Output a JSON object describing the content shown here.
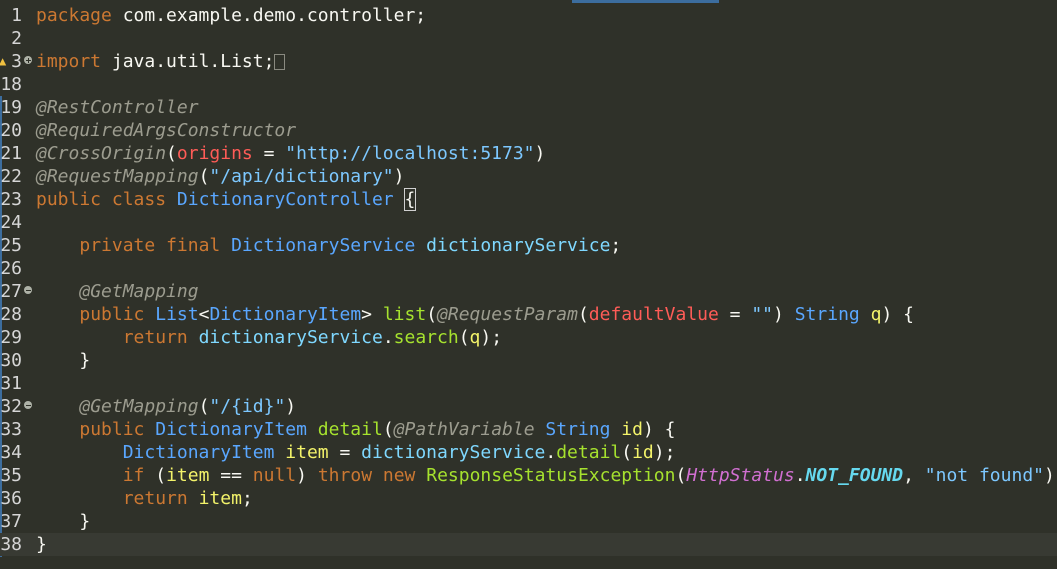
{
  "editor": {
    "lines": [
      {
        "n": "1",
        "tokens": [
          [
            "kw",
            "package"
          ],
          [
            "pl",
            " com.example.demo.controller;"
          ]
        ]
      },
      {
        "n": "2",
        "tokens": []
      },
      {
        "n": "3",
        "fold": "plus",
        "warn": true,
        "tokens": [
          [
            "kw",
            "import"
          ],
          [
            "pl",
            " java.util.List;"
          ]
        ],
        "collapsed": true
      },
      {
        "n": "18",
        "tokens": []
      },
      {
        "n": "19",
        "tokens": [
          [
            "an",
            "@RestController"
          ]
        ]
      },
      {
        "n": "20",
        "tokens": [
          [
            "an",
            "@RequiredArgsConstructor"
          ]
        ]
      },
      {
        "n": "21",
        "tokens": [
          [
            "an",
            "@CrossOrigin"
          ],
          [
            "pl",
            "("
          ],
          [
            "pm",
            "origins"
          ],
          [
            "pl",
            " = "
          ],
          [
            "st",
            "\"http://localhost:5173\""
          ],
          [
            "pl",
            ")"
          ]
        ]
      },
      {
        "n": "22",
        "tokens": [
          [
            "an",
            "@RequestMapping"
          ],
          [
            "pl",
            "("
          ],
          [
            "st",
            "\"/api/dictionary\""
          ],
          [
            "pl",
            ")"
          ]
        ]
      },
      {
        "n": "23",
        "tokens": [
          [
            "kw",
            "public"
          ],
          [
            "pl",
            " "
          ],
          [
            "kw",
            "class"
          ],
          [
            "pl",
            " "
          ],
          [
            "tp",
            "DictionaryController"
          ],
          [
            "pl",
            " "
          ],
          [
            "brace",
            "{"
          ]
        ]
      },
      {
        "n": "24",
        "tokens": []
      },
      {
        "n": "25",
        "tokens": [
          [
            "pl",
            "    "
          ],
          [
            "kw",
            "private"
          ],
          [
            "pl",
            " "
          ],
          [
            "kw",
            "final"
          ],
          [
            "pl",
            " "
          ],
          [
            "tp",
            "DictionaryService"
          ],
          [
            "pl",
            " "
          ],
          [
            "fld",
            "dictionaryService"
          ],
          [
            "pl",
            ";"
          ]
        ]
      },
      {
        "n": "26",
        "tokens": []
      },
      {
        "n": "27",
        "fold": "minus",
        "tokens": [
          [
            "pl",
            "    "
          ],
          [
            "an",
            "@GetMapping"
          ]
        ]
      },
      {
        "n": "28",
        "tokens": [
          [
            "pl",
            "    "
          ],
          [
            "kw",
            "public"
          ],
          [
            "pl",
            " "
          ],
          [
            "tp",
            "List"
          ],
          [
            "pl",
            "<"
          ],
          [
            "tp",
            "DictionaryItem"
          ],
          [
            "pl",
            "> "
          ],
          [
            "mt",
            "list"
          ],
          [
            "pl",
            "("
          ],
          [
            "an",
            "@RequestParam"
          ],
          [
            "pl",
            "("
          ],
          [
            "pm",
            "defaultValue"
          ],
          [
            "pl",
            " = "
          ],
          [
            "st",
            "\"\""
          ],
          [
            "pl",
            ") "
          ],
          [
            "tp",
            "String"
          ],
          [
            "pl",
            " "
          ],
          [
            "id",
            "q"
          ],
          [
            "pl",
            ") {"
          ]
        ]
      },
      {
        "n": "29",
        "tokens": [
          [
            "pl",
            "        "
          ],
          [
            "kw",
            "return"
          ],
          [
            "pl",
            " "
          ],
          [
            "fld",
            "dictionaryService"
          ],
          [
            "pl",
            "."
          ],
          [
            "mt",
            "search"
          ],
          [
            "pl",
            "("
          ],
          [
            "id",
            "q"
          ],
          [
            "pl",
            ");"
          ]
        ]
      },
      {
        "n": "30",
        "tokens": [
          [
            "pl",
            "    }"
          ]
        ]
      },
      {
        "n": "31",
        "tokens": []
      },
      {
        "n": "32",
        "fold": "minus",
        "tokens": [
          [
            "pl",
            "    "
          ],
          [
            "an",
            "@GetMapping"
          ],
          [
            "pl",
            "("
          ],
          [
            "st",
            "\"/{id}\""
          ],
          [
            "pl",
            ")"
          ]
        ]
      },
      {
        "n": "33",
        "tokens": [
          [
            "pl",
            "    "
          ],
          [
            "kw",
            "public"
          ],
          [
            "pl",
            " "
          ],
          [
            "tp",
            "DictionaryItem"
          ],
          [
            "pl",
            " "
          ],
          [
            "mt",
            "detail"
          ],
          [
            "pl",
            "("
          ],
          [
            "an",
            "@PathVariable"
          ],
          [
            "pl",
            " "
          ],
          [
            "tp",
            "String"
          ],
          [
            "pl",
            " "
          ],
          [
            "id",
            "id"
          ],
          [
            "pl",
            ") {"
          ]
        ]
      },
      {
        "n": "34",
        "tokens": [
          [
            "pl",
            "        "
          ],
          [
            "tp",
            "DictionaryItem"
          ],
          [
            "pl",
            " "
          ],
          [
            "id",
            "item"
          ],
          [
            "pl",
            " = "
          ],
          [
            "fld",
            "dictionaryService"
          ],
          [
            "pl",
            "."
          ],
          [
            "mt",
            "detail"
          ],
          [
            "pl",
            "("
          ],
          [
            "id",
            "id"
          ],
          [
            "pl",
            ");"
          ]
        ]
      },
      {
        "n": "35",
        "tokens": [
          [
            "pl",
            "        "
          ],
          [
            "kw",
            "if"
          ],
          [
            "pl",
            " ("
          ],
          [
            "id",
            "item"
          ],
          [
            "pl",
            " == "
          ],
          [
            "kw",
            "null"
          ],
          [
            "pl",
            ") "
          ],
          [
            "kw",
            "throw"
          ],
          [
            "pl",
            " "
          ],
          [
            "kw",
            "new"
          ],
          [
            "pl",
            " "
          ],
          [
            "mt",
            "ResponseStatusException"
          ],
          [
            "pl",
            "("
          ],
          [
            "cls-it",
            "HttpStatus"
          ],
          [
            "pl",
            "."
          ],
          [
            "const",
            "NOT_FOUND"
          ],
          [
            "pl",
            ", "
          ],
          [
            "st",
            "\"not found\""
          ],
          [
            "pl",
            ");"
          ]
        ]
      },
      {
        "n": "36",
        "tokens": [
          [
            "pl",
            "        "
          ],
          [
            "kw",
            "return"
          ],
          [
            "pl",
            " "
          ],
          [
            "id",
            "item"
          ],
          [
            "pl",
            ";"
          ]
        ]
      },
      {
        "n": "37",
        "tokens": [
          [
            "pl",
            "    }"
          ]
        ]
      },
      {
        "n": "38",
        "current": true,
        "tokens": [
          [
            "pl",
            "}"
          ]
        ]
      }
    ]
  }
}
